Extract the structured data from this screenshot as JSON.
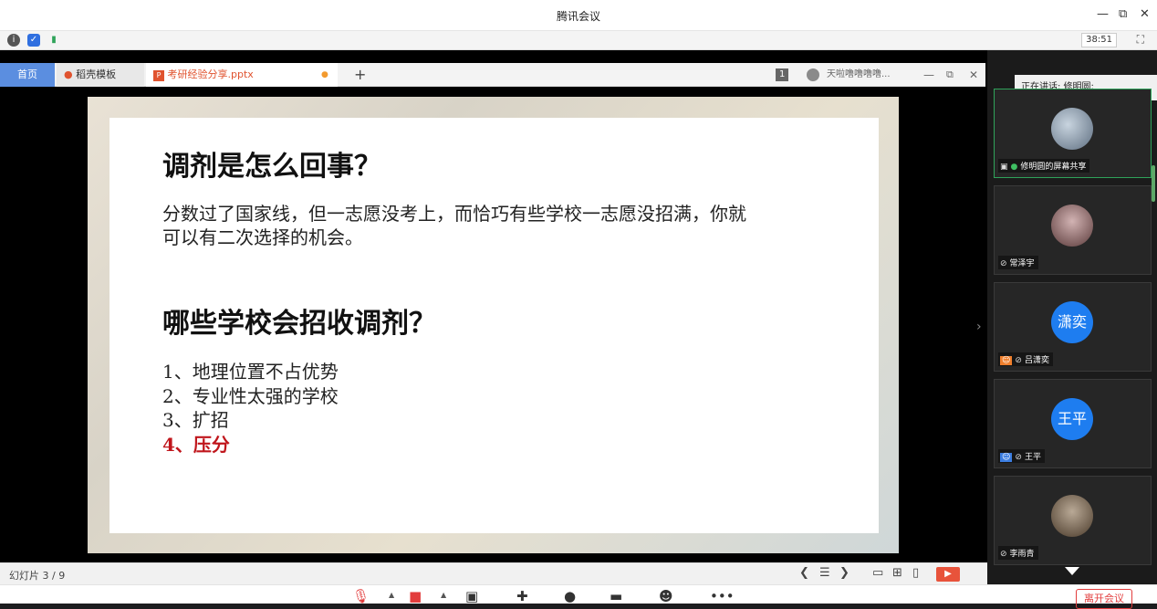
{
  "window": {
    "title": "腾讯会议",
    "controls": [
      "—",
      "⧉",
      "✕"
    ]
  },
  "infobar": {
    "timer": "38:51",
    "icons": [
      "info-icon",
      "shield-icon",
      "signal-icon"
    ]
  },
  "tabs": {
    "home": "首页",
    "doc": "稻壳模板",
    "ppt": "考研经验分享.pptx",
    "ppt_dot": "●",
    "add": "+",
    "page_badge": "1",
    "user": "天啦噜噜噜噜...",
    "win_controls": [
      "—",
      "⧉",
      "✕"
    ]
  },
  "slide": {
    "heading1": "调剂是怎么回事？",
    "para_line1": "分数过了国家线，但一志愿没考上，而恰巧有些学校一志愿没招满，你就",
    "para_line2": "可以有二次选择的机会。",
    "heading2": "哪些学校会招收调剂？",
    "items": [
      "1、地理位置不占优势",
      "2、专业性太强的学校",
      "3、扩招",
      "4、压分"
    ]
  },
  "slidebar": {
    "count": "幻灯片 3 / 9",
    "controls": {
      "prev": "❮",
      "list": "☰",
      "next": "❯",
      "view1": "▭",
      "view2": "⊞",
      "view3": "▯",
      "play": "▶"
    }
  },
  "speaking": "正在讲话: 修明圆;",
  "participants": [
    {
      "name": "修明圆的屏幕共享",
      "type": "photo",
      "color": "#7f8f9f",
      "active": true
    },
    {
      "name": "常泽宇",
      "type": "photo",
      "color": "#8a5a5a",
      "active": false
    },
    {
      "name": "吕潇奕",
      "type": "text",
      "avatar_text": "潇奕",
      "active": false
    },
    {
      "name": "王平",
      "type": "text",
      "avatar_text": "王平",
      "active": false
    },
    {
      "name": "李雨青",
      "type": "photo",
      "color": "#6a5a4a",
      "active": false
    }
  ],
  "toolbar": {
    "leave": "离开会议",
    "icons": [
      "mic-muted-icon",
      "camera-off-icon",
      "share-screen-icon",
      "invite-icon",
      "members-icon",
      "chat-icon",
      "emoji-icon",
      "more-icon"
    ]
  },
  "colors": {
    "accent": "#1e7df0",
    "danger": "#e23c3c",
    "slide_red": "#c0161c"
  }
}
